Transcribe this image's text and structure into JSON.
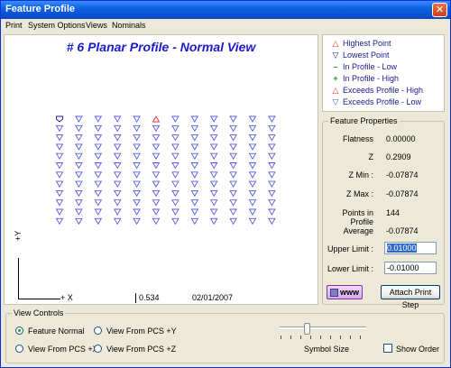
{
  "window": {
    "title": "Feature Profile",
    "close_glyph": "✕"
  },
  "menu": [
    "Print",
    "System Options",
    "Views",
    "Nominals"
  ],
  "plot": {
    "title": "# 6 Planar Profile - Normal View",
    "axis_y_label": "+Y",
    "axis_x_label": "+ X",
    "scale": "0.534",
    "date": "02/01/2007",
    "grid": {
      "cols": 12,
      "rows": 12,
      "highest": {
        "row": 0,
        "col": 5
      },
      "lowest": {
        "row": 0,
        "col": 0
      }
    },
    "colors": {
      "exceeds_low": "#5A5AE0",
      "highest": "#E03030",
      "lowest": "#1A1A8C"
    }
  },
  "legend": [
    {
      "label": "Highest Point",
      "symbol": "up-triangle-outline-red"
    },
    {
      "label": "Lowest Point",
      "symbol": "down-shield-navy"
    },
    {
      "label": "In Profile - Low",
      "symbol": "minus-green"
    },
    {
      "label": "In Profile - High",
      "symbol": "plus-green"
    },
    {
      "label": "Exceeds Profile - High",
      "symbol": "up-triangle-red"
    },
    {
      "label": "Exceeds Profile - Low",
      "symbol": "down-triangle-blue"
    }
  ],
  "properties": {
    "title": "Feature Properties",
    "flatness_label": "Flatness",
    "flatness": "0.00000",
    "z_label": "Z",
    "z": "0.2909",
    "zmin_label": "Z Min :",
    "zmin": "-0.07874",
    "zmax_label": "Z Max :",
    "zmax": "-0.07874",
    "points_label": "Points in Profile",
    "points": "144",
    "average_label": "Average",
    "average": "-0.07874",
    "upper_label": "Upper Limit :",
    "upper": "0.01000",
    "lower_label": "Lower Limit :",
    "lower": "-0.01000",
    "www_label": "www",
    "attach_label": "Attach Print Step"
  },
  "view_controls": {
    "title": "View Controls",
    "options": [
      "Feature Normal",
      "View From PCS +Y",
      "View From PCS +X",
      "View From PCS +Z"
    ],
    "selected": "Feature Normal",
    "symbol_size_label": "Symbol Size",
    "symbol_size": 0.2,
    "show_order_label": "Show Order",
    "show_order_checked": false
  }
}
